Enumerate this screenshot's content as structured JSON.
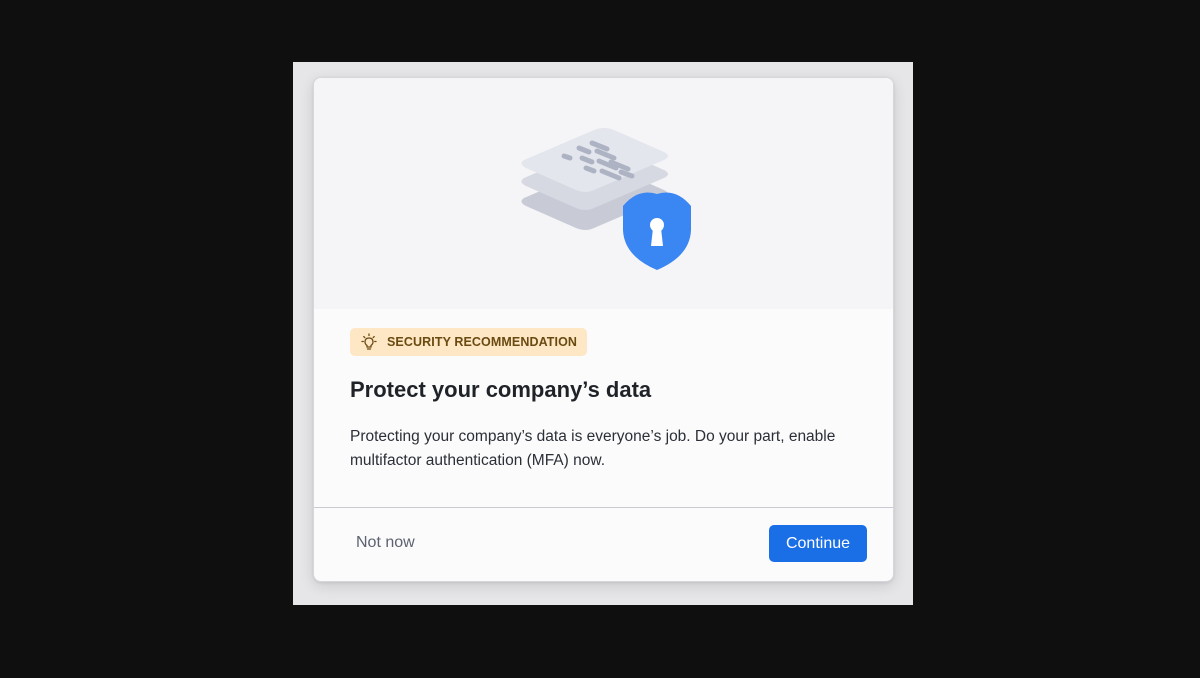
{
  "dialog": {
    "badge_label": "SECURITY RECOMMENDATION",
    "badge_icon": "lightbulb-icon",
    "title": "Protect your company’s data",
    "description": "Protecting your company’s data is everyone’s job. Do your part, enable multifactor authentication (MFA) now.",
    "illustration": "document-stack-with-shield-lock",
    "buttons": {
      "secondary_label": "Not now",
      "primary_label": "Continue"
    }
  },
  "colors": {
    "primary": "#1a6ee6",
    "badge_bg": "#fde7c4",
    "badge_text": "#6b4a12",
    "shield": "#3a86f2",
    "backdrop": "#0f0f10"
  }
}
